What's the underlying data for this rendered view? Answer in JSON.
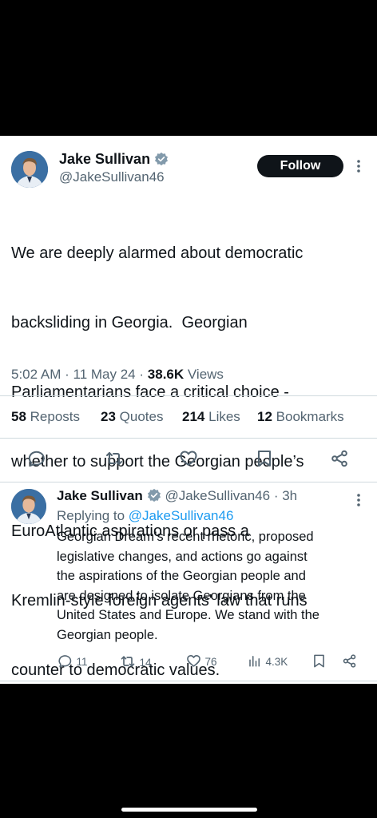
{
  "main_tweet": {
    "author_name": "Jake Sullivan",
    "handle": "@JakeSullivan46",
    "follow_label": "Follow",
    "text_lines": [
      "We are deeply alarmed about democratic",
      "backsliding in Georgia.  Georgian",
      "Parliamentarians face a critical choice -",
      "whether to support the Georgian people’s",
      "EuroAtlantic aspirations or pass a",
      "Kremlin-style foreign agents' law that runs",
      "counter to democratic values."
    ],
    "time": "5:02 AM",
    "date": "11 May 24",
    "views_count": "38.6K",
    "views_label": "Views",
    "stats": {
      "reposts_count": "58",
      "reposts_label": "Reposts",
      "quotes_count": "23",
      "quotes_label": "Quotes",
      "likes_count": "214",
      "likes_label": "Likes",
      "bookmarks_count": "12",
      "bookmarks_label": "Bookmarks"
    },
    "icons": [
      "reply-icon",
      "repost-icon",
      "like-icon",
      "bookmark-icon",
      "share-icon"
    ]
  },
  "reply_tweet": {
    "author_name": "Jake Sullivan",
    "handle": "@JakeSullivan46",
    "age": "3h",
    "replying_to_label": "Replying to",
    "replying_to_handle": "@JakeSullivan46",
    "text_lines": [
      "Georgian Dream’s recent rhetoric, proposed",
      "legislative changes, and actions go against",
      "the aspirations of the Georgian people and",
      "are designed to isolate Georgians from the",
      "United States and Europe.  We stand with the",
      "Georgian people."
    ],
    "actions": {
      "replies": "11",
      "reposts": "14",
      "likes": "76",
      "views": "4.3K"
    }
  },
  "colors": {
    "accent": "#1d9bf0",
    "text_primary": "#0f1419",
    "text_secondary": "#536471",
    "divider": "#cfd9de",
    "background": "#ffffff",
    "frame": "#000000"
  }
}
